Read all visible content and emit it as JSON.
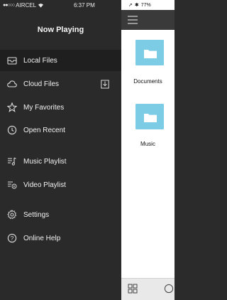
{
  "status": {
    "carrier": "AIRCEL",
    "time": "6:37 PM",
    "battery": "77%"
  },
  "drawer": {
    "title": "Now Playing",
    "items": [
      {
        "label": "Local Files",
        "icon": "inbox-icon",
        "active": true
      },
      {
        "label": "Cloud Files",
        "icon": "cloud-icon",
        "trailing_icon": "download-icon"
      },
      {
        "label": "My Favorites",
        "icon": "star-icon"
      },
      {
        "label": "Open Recent",
        "icon": "clock-icon"
      },
      {
        "label": "Music Playlist",
        "icon": "music-list-icon"
      },
      {
        "label": "Video Playlist",
        "icon": "video-list-icon"
      },
      {
        "label": "Settings",
        "icon": "gear-icon"
      },
      {
        "label": "Online Help",
        "icon": "help-icon"
      }
    ]
  },
  "files": [
    {
      "label": "Documents",
      "icon": "folder-icon"
    },
    {
      "label": "Music",
      "icon": "folder-icon"
    }
  ],
  "colors": {
    "drawer_bg": "#2a2a2a",
    "active_bg": "#1f1f1f",
    "folder": "#7ccce6",
    "topbar": "#3a3a3a"
  }
}
